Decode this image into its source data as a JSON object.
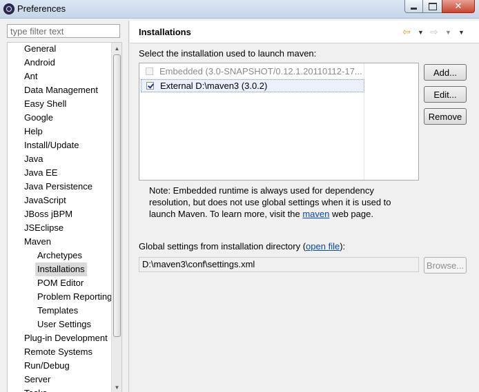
{
  "window": {
    "title": "Preferences",
    "close_glyph": "✕"
  },
  "filter": {
    "placeholder": "type filter text"
  },
  "tree": {
    "items": [
      "General",
      "Android",
      "Ant",
      "Data Management",
      "Easy Shell",
      "Google",
      "Help",
      "Install/Update",
      "Java",
      "Java EE",
      "Java Persistence",
      "JavaScript",
      "JBoss jBPM",
      "JSEclipse",
      "Maven",
      "Archetypes",
      "Installations",
      "POM Editor",
      "Problem Reporting",
      "Templates",
      "User Settings",
      "Plug-in Development",
      "Remote Systems",
      "Run/Debug",
      "Server",
      "Tasks"
    ],
    "selected": "Installations"
  },
  "page": {
    "title": "Installations",
    "nav_icons": [
      "back-arrow-icon",
      "dropdown-icon",
      "forward-arrow-icon",
      "dropdown-icon",
      "view-menu-icon"
    ],
    "select_label": "Select the installation used to launch maven:",
    "installations": [
      {
        "label": "Embedded (3.0-SNAPSHOT/0.12.1.20110112-17...",
        "checked": false,
        "enabled": false
      },
      {
        "label": "External D:\\maven3 (3.0.2)",
        "checked": true,
        "enabled": true
      }
    ],
    "buttons": {
      "add": "Add...",
      "edit": "Edit...",
      "remove": "Remove",
      "browse": "Browse..."
    },
    "note": {
      "before": "Note: Embedded runtime is always used for dependency resolution, but does not use global settings when it is used to launch Maven. To learn more, visit the ",
      "link": "maven",
      "after": " web page."
    },
    "global": {
      "before": "Global settings from installation directory (",
      "link": "open file",
      "after": "):",
      "path": "D:\\maven3\\conf\\settings.xml"
    }
  }
}
